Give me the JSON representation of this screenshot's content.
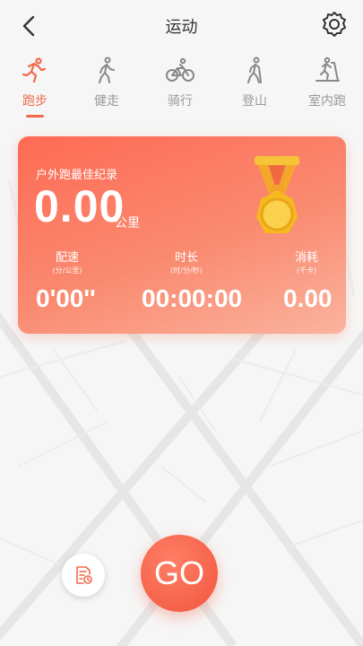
{
  "header": {
    "title": "运动"
  },
  "tabs": [
    {
      "label": "跑步",
      "icon": "run-icon",
      "active": true
    },
    {
      "label": "健走",
      "icon": "walk-icon",
      "active": false
    },
    {
      "label": "骑行",
      "icon": "bike-icon",
      "active": false
    },
    {
      "label": "登山",
      "icon": "hike-icon",
      "active": false
    },
    {
      "label": "室内跑",
      "icon": "treadmill-icon",
      "active": false
    }
  ],
  "record": {
    "title": "户外跑最佳纪录",
    "distance": "0.00",
    "distance_unit": "公里",
    "stats": [
      {
        "label": "配速",
        "unit": "(分/公里)",
        "value": "0'00''"
      },
      {
        "label": "时长",
        "unit": "(时/分/秒)",
        "value": "00:00:00"
      },
      {
        "label": "消耗",
        "unit": "(千卡)",
        "value": "0.00"
      }
    ]
  },
  "actions": {
    "go_label": "GO"
  },
  "colors": {
    "accent": "#f2694b",
    "card_start": "#ff6a55",
    "card_end": "#fbb39e",
    "medal_gold": "#f6b91e"
  }
}
